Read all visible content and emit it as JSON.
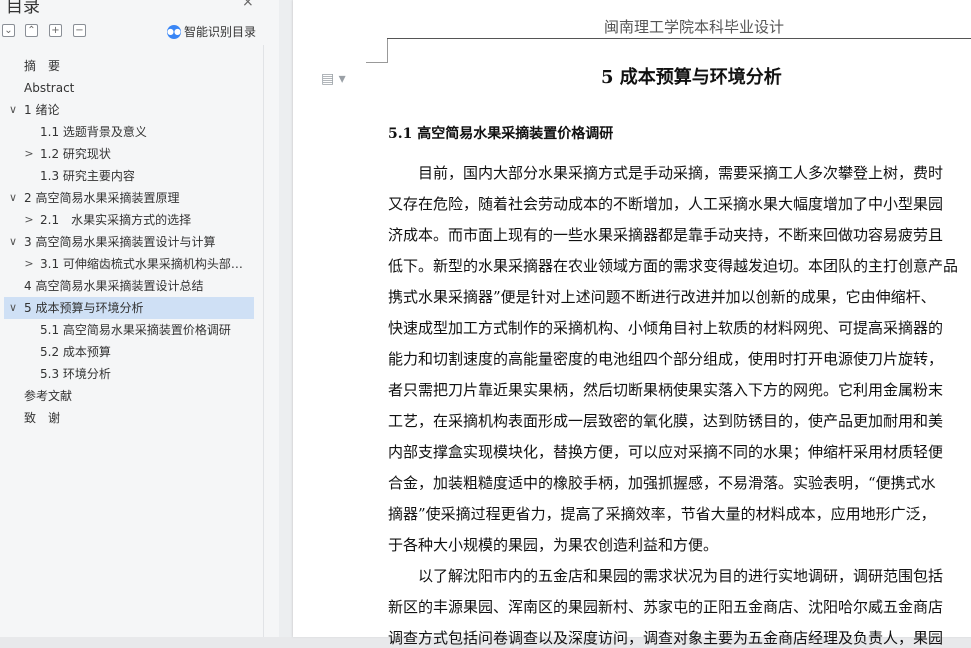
{
  "nav": {
    "title": "目录",
    "close_icon": "×",
    "smart_toc_label": "智能识别目录",
    "items": [
      {
        "label": "摘　要",
        "level": 0,
        "chevron": ""
      },
      {
        "label": "Abstract",
        "level": 0,
        "chevron": ""
      },
      {
        "label": "1  绪论",
        "level": 0,
        "chevron": "∨"
      },
      {
        "label": "1.1  选题背景及意义",
        "level": 1,
        "chevron": ""
      },
      {
        "label": "1.2 研究现状",
        "level": 1,
        "chevron": ">"
      },
      {
        "label": "1.3 研究主要内容",
        "level": 1,
        "chevron": ""
      },
      {
        "label": "2  高空简易水果采摘装置原理",
        "level": 0,
        "chevron": "∨"
      },
      {
        "label": "2.1　水果实采摘方式的选择",
        "level": 1,
        "chevron": ">"
      },
      {
        "label": "3  高空简易水果采摘装置设计与计算",
        "level": 0,
        "chevron": "∨"
      },
      {
        "label": "3.1 可伸缩齿梳式水果采摘机构头部…",
        "level": 1,
        "chevron": ">"
      },
      {
        "label": "4  高空简易水果采摘装置设计总结",
        "level": 0,
        "chevron": ""
      },
      {
        "label": "5  成本预算与环境分析",
        "level": 0,
        "chevron": "∨",
        "active": true
      },
      {
        "label": "5.1  高空简易水果采摘装置价格调研",
        "level": 1,
        "chevron": ""
      },
      {
        "label": "5.2  成本预算",
        "level": 1,
        "chevron": ""
      },
      {
        "label": "5.3  环境分析",
        "level": 1,
        "chevron": ""
      },
      {
        "label": "参考文献",
        "level": 0,
        "chevron": ""
      },
      {
        "label": "致　谢",
        "level": 0,
        "chevron": ""
      }
    ]
  },
  "doc": {
    "header": "闽南理工学院本科毕业设计",
    "chapter_title": "5  成本预算与环境分析",
    "section_title": "5.1  高空简易水果采摘装置价格调研",
    "lines": [
      "　　目前，国内大部分水果采摘方式是手动采摘，需要采摘工人多次攀登上树，费时",
      "又存在危险，随着社会劳动成本的不断增加，人工采摘水果大幅度增加了中小型果园",
      "济成本。而市面上现有的一些水果采摘器都是靠手动夹持，不断来回做功容易疲劳且",
      "低下。新型的水果采摘器在农业领域方面的需求变得越发迫切。本团队的主打创意产品",
      "携式水果采摘器”便是针对上述问题不断进行改进并加以创新的成果，它由伸缩杆、",
      "快速成型加工方式制作的采摘机构、小倾角目衬上软质的材料网兜、可提高采摘器的",
      "能力和切割速度的高能量密度的电池组四个部分组成，使用时打开电源使刀片旋转，",
      "者只需把刀片靠近果实果柄，然后切断果柄使果实落入下方的网兜。它利用金属粉末",
      "工艺，在采摘机构表面形成一层致密的氧化膜，达到防锈目的，使产品更加耐用和美",
      "内部支撑盒实现模块化，替换方便，可以应对采摘不同的水果；伸缩杆采用材质轻便",
      "合金，加装粗糙度适中的橡胶手柄，加强抓握感，不易滑落。实验表明，“便携式水",
      "摘器”使采摘过程更省力，提高了采摘效率，节省大量的材料成本，应用地形广泛，",
      "于各种大小规模的果园，为果农创造利益和方便。",
      "　　以了解沈阳市内的五金店和果园的需求状况为目的进行实地调研，调研范围包括",
      "新区的丰源果园、浑南区的果园新村、苏家屯的正阳五金商店、沈阳哈尔威五金商店",
      "调查方式包括问卷调查以及深度访问，调查对象主要为五金商店经理及负责人，果园"
    ]
  }
}
